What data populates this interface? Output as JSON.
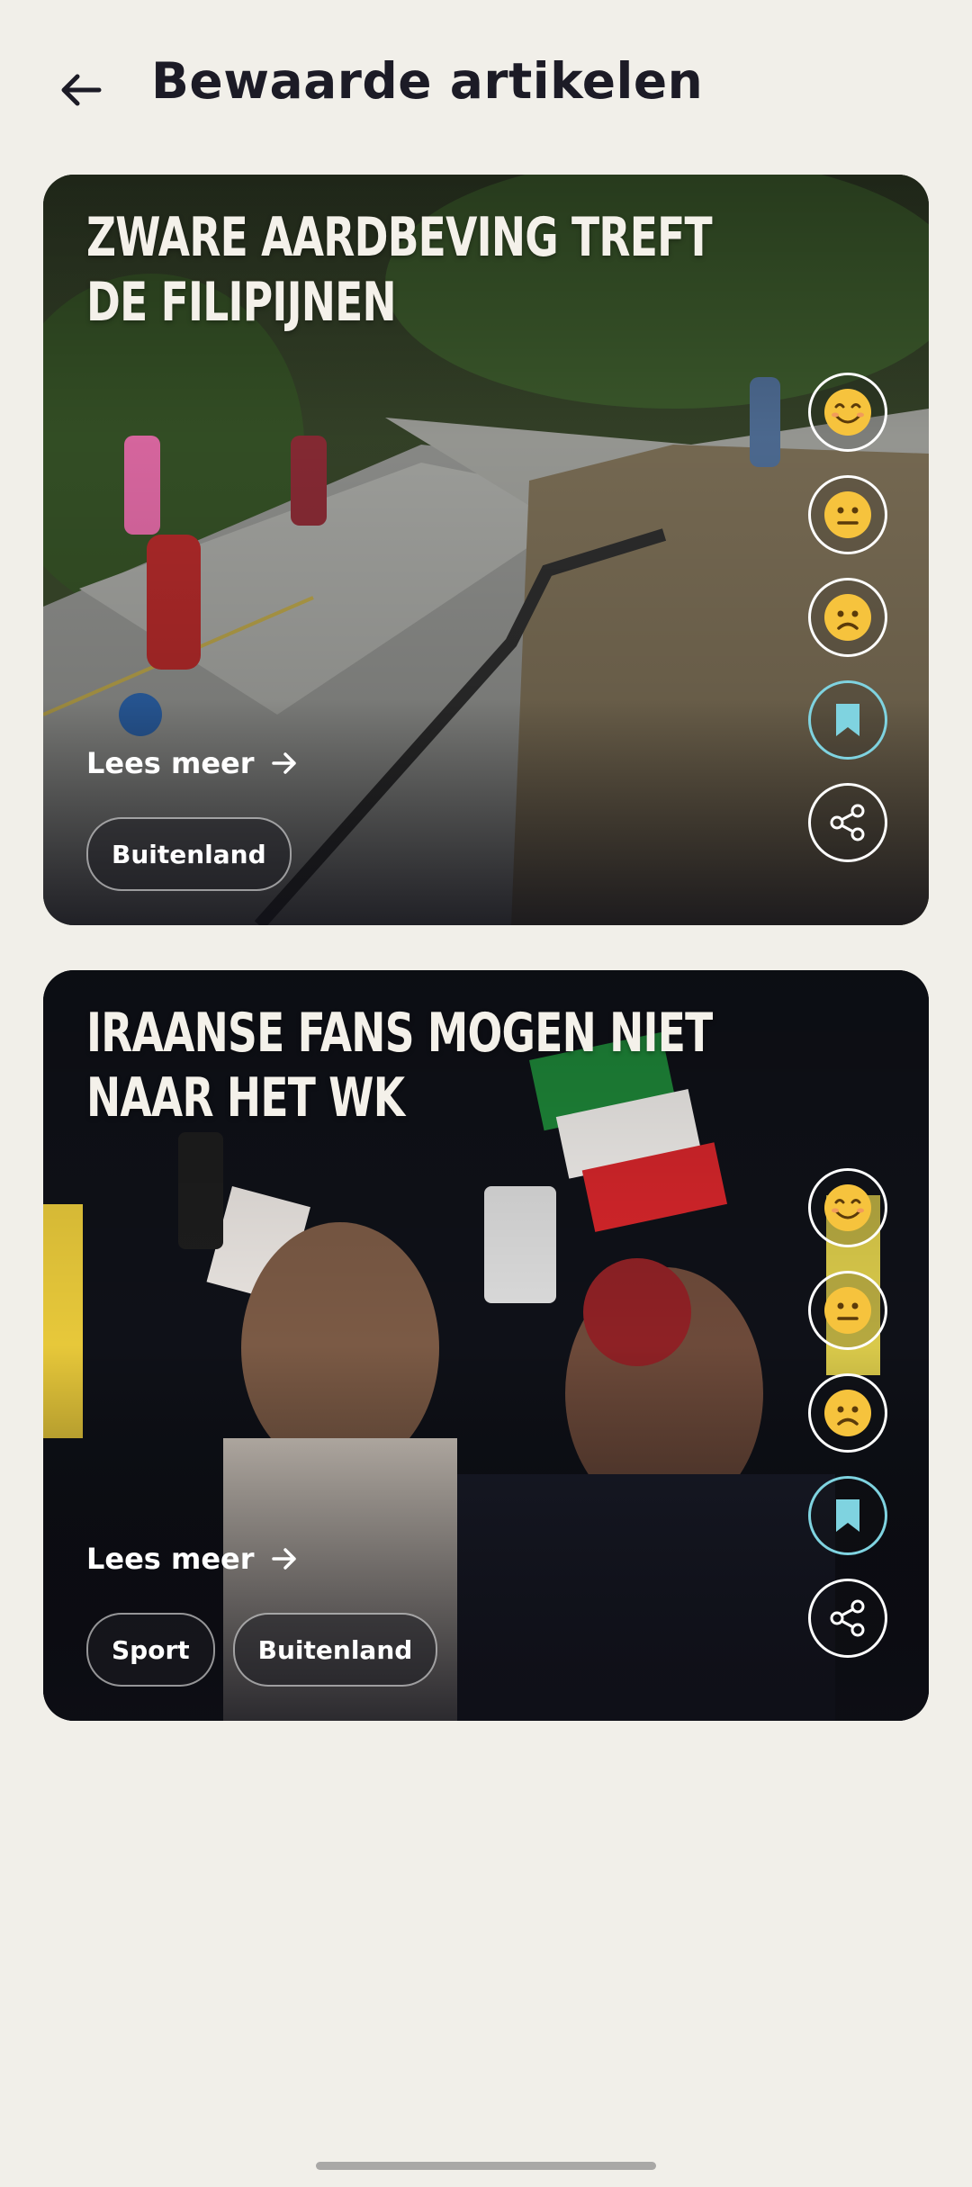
{
  "header": {
    "title": "Bewaarde artikelen",
    "back_icon": "arrow-left-icon"
  },
  "articles": [
    {
      "headline_line1": "ZWARE AARDBEVING TREFT",
      "headline_line2": "DE FILIPIJNEN",
      "read_more": "Lees meer",
      "tags": [
        "Buitenland"
      ],
      "saved": true,
      "image": "earthquake-road-photo"
    },
    {
      "headline_line1": "IRAANSE FANS MOGEN NIET",
      "headline_line2": "NAAR HET WK",
      "read_more": "Lees meer",
      "tags": [
        "Sport",
        "Buitenland"
      ],
      "saved": true,
      "image": "iranian-fans-photo"
    }
  ],
  "actions": {
    "happy_icon": "happy-emoji-icon",
    "neutral_icon": "neutral-emoji-icon",
    "sad_icon": "sad-emoji-icon",
    "bookmark_icon": "bookmark-icon",
    "share_icon": "share-icon"
  },
  "colors": {
    "background": "#f1efe9",
    "title": "#1c1b26",
    "bookmark_accent": "#7fd3e0",
    "emoji": "#f6c33d"
  }
}
